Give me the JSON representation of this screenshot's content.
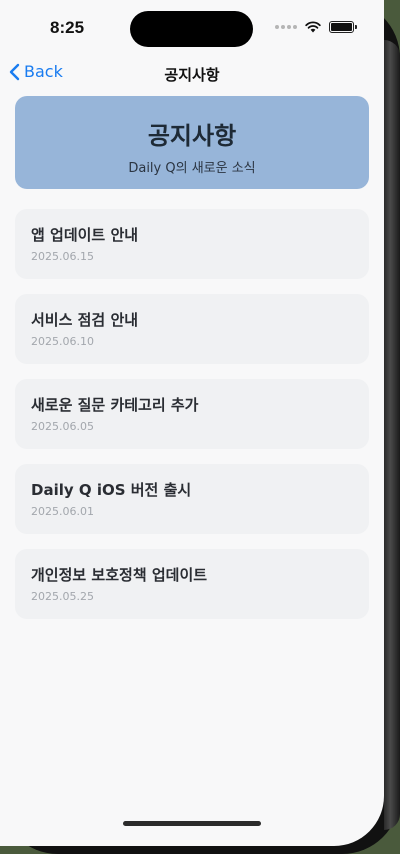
{
  "status_bar": {
    "time": "8:25"
  },
  "nav": {
    "back_label": "Back",
    "title": "공지사항"
  },
  "banner": {
    "title": "공지사항",
    "subtitle": "Daily Q의 새로운 소식"
  },
  "notices": [
    {
      "title": "앱 업데이트 안내",
      "date": "2025.06.15"
    },
    {
      "title": "서비스 점검 안내",
      "date": "2025.06.10"
    },
    {
      "title": "새로운 질문 카테고리 추가",
      "date": "2025.06.05"
    },
    {
      "title": "Daily Q iOS 버전 출시",
      "date": "2025.06.01"
    },
    {
      "title": "개인정보 보호정책 업데이트",
      "date": "2025.05.25"
    }
  ],
  "colors": {
    "accent": "#1a7cf0",
    "banner": "#97b5d9",
    "card": "#f0f1f3"
  }
}
